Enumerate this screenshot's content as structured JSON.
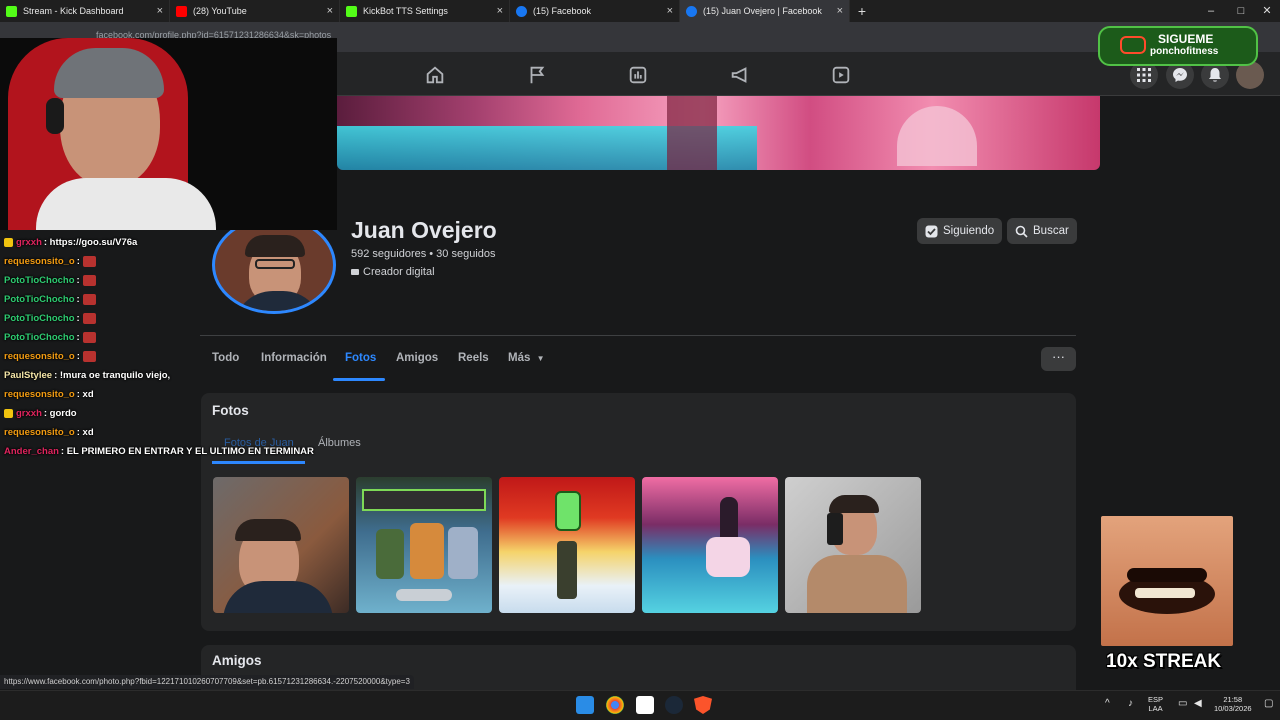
{
  "browser": {
    "tabs": [
      {
        "label": "Stream - Kick Dashboard",
        "color": "#53fc18"
      },
      {
        "label": "(28) YouTube",
        "color": "#ff0000"
      },
      {
        "label": "KickBot TTS Settings",
        "color": "#53fc18"
      },
      {
        "label": "(15) Facebook",
        "color": "#1877f2"
      },
      {
        "label": "(15) Juan Ovejero | Facebook",
        "color": "#1877f2"
      }
    ],
    "close_glyph": "×",
    "new_tab_glyph": "+",
    "url": "facebook.com/profile.php?id=61571231286634&sk=photos"
  },
  "fb_nav": {
    "icons": [
      "home-icon",
      "flag-icon",
      "chart-icon",
      "megaphone-icon",
      "reels-icon"
    ]
  },
  "profile": {
    "name": "Juan Ovejero",
    "stats": "592 seguidores • 30 seguidos",
    "creator": "Creador digital",
    "following_label": "Siguiendo",
    "search_label": "Buscar",
    "tabs": [
      "Todo",
      "Información",
      "Fotos",
      "Amigos",
      "Reels",
      "Más"
    ],
    "active_tab": "Fotos",
    "more_glyph": "···"
  },
  "photos": {
    "title": "Fotos",
    "subtabs": [
      "Fotos de Juan",
      "Álbumes"
    ],
    "items": [
      "selfie-photo",
      "game-characters-photo",
      "game-reward-photo",
      "anime-pool-photo",
      "mirror-selfie-photo"
    ]
  },
  "amigos": {
    "title": "Amigos"
  },
  "chat": [
    {
      "user": "grxxh",
      "color": "#e0245e",
      "badge": true,
      "msg": ": https://goo.su/V76a",
      "emote": false
    },
    {
      "user": "requesonsito_o",
      "color": "#f39c12",
      "badge": false,
      "msg": " :",
      "emote": true
    },
    {
      "user": "PotoTioChocho",
      "color": "#2ecc71",
      "badge": false,
      "msg": " :",
      "emote": true
    },
    {
      "user": "PotoTioChocho",
      "color": "#2ecc71",
      "badge": false,
      "msg": " :",
      "emote": true
    },
    {
      "user": "PotoTioChocho",
      "color": "#2ecc71",
      "badge": false,
      "msg": " :",
      "emote": true
    },
    {
      "user": "PotoTioChocho",
      "color": "#2ecc71",
      "badge": false,
      "msg": " :",
      "emote": true
    },
    {
      "user": "requesonsito_o",
      "color": "#f39c12",
      "badge": false,
      "msg": " :",
      "emote": true
    },
    {
      "user": "PaulStylee",
      "color": "#f5e6a8",
      "badge": false,
      "msg": " : !mura oe tranquilo viejo,",
      "emote": false
    },
    {
      "user": "requesonsito_o",
      "color": "#f39c12",
      "badge": false,
      "msg": " : xd",
      "emote": false
    },
    {
      "user": "grxxh",
      "color": "#e0245e",
      "badge": true,
      "msg": " : gordo",
      "emote": false
    },
    {
      "user": "requesonsito_o",
      "color": "#f39c12",
      "badge": false,
      "msg": " : xd",
      "emote": false
    },
    {
      "user": "Ander_chan",
      "color": "#e0245e",
      "badge": false,
      "msg": " : EL PRIMERO EN ENTRAR Y EL ULTIMO EN TERMINAR",
      "emote": false
    }
  ],
  "overlay": {
    "follow_title": "SIGUEME",
    "follow_handle": "ponchofitness",
    "streak": "10x STREAK"
  },
  "status_url": "https://www.facebook.com/photo.php?fbid=122171010260707709&set=pb.61571231286634.-2207520000&type=3",
  "tray": {
    "lang_top": "ESP",
    "lang_bottom": "LAA",
    "time": "21:58",
    "date": "10/03/2026"
  }
}
